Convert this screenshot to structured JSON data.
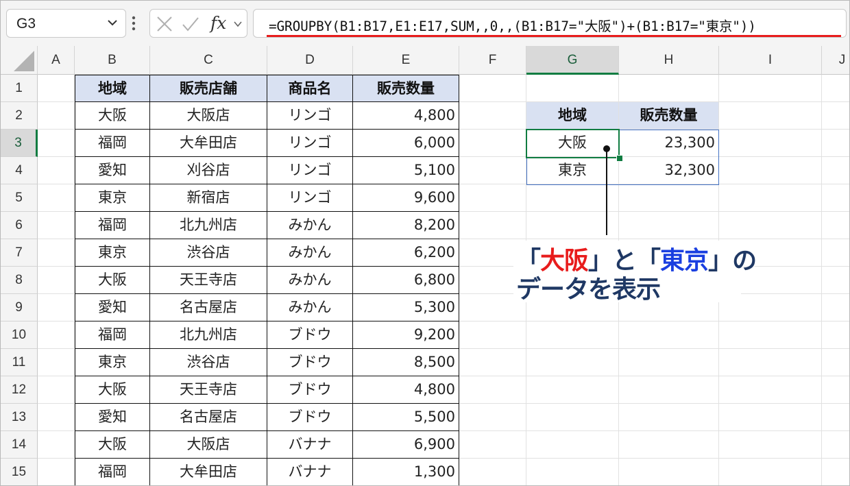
{
  "formula_bar": {
    "name_box": "G3",
    "formula": "=GROUPBY(B1:B17,E1:E17,SUM,,0,,(B1:B17=\"大阪\")+(B1:B17=\"東京\"))",
    "icons": [
      "chevron-down-icon",
      "more-vertical-icon",
      "cancel-icon",
      "enter-check-icon",
      "function-icon"
    ]
  },
  "grid": {
    "columns": [
      "A",
      "B",
      "C",
      "D",
      "E",
      "F",
      "G",
      "H",
      "I",
      "J"
    ],
    "selected_column": "G",
    "rows": [
      "1",
      "2",
      "3",
      "4",
      "5",
      "6",
      "7",
      "8",
      "9",
      "10",
      "11",
      "12",
      "13",
      "14",
      "15"
    ],
    "selected_row": "3"
  },
  "table": {
    "headers": [
      "地域",
      "販売店舗",
      "商品名",
      "販売数量"
    ],
    "rows": [
      [
        "大阪",
        "大阪店",
        "リンゴ",
        "4,800"
      ],
      [
        "福岡",
        "大牟田店",
        "リンゴ",
        "6,000"
      ],
      [
        "愛知",
        "刈谷店",
        "リンゴ",
        "5,100"
      ],
      [
        "東京",
        "新宿店",
        "リンゴ",
        "9,600"
      ],
      [
        "福岡",
        "北九州店",
        "みかん",
        "8,200"
      ],
      [
        "東京",
        "渋谷店",
        "みかん",
        "6,200"
      ],
      [
        "大阪",
        "天王寺店",
        "みかん",
        "6,800"
      ],
      [
        "愛知",
        "名古屋店",
        "みかん",
        "5,300"
      ],
      [
        "福岡",
        "北九州店",
        "ブドウ",
        "9,200"
      ],
      [
        "東京",
        "渋谷店",
        "ブドウ",
        "8,500"
      ],
      [
        "大阪",
        "天王寺店",
        "ブドウ",
        "4,800"
      ],
      [
        "愛知",
        "名古屋店",
        "ブドウ",
        "5,500"
      ],
      [
        "大阪",
        "大阪店",
        "バナナ",
        "6,900"
      ],
      [
        "福岡",
        "大牟田店",
        "バナナ",
        "1,300"
      ]
    ]
  },
  "result": {
    "headers": [
      "地域",
      "販売数量"
    ],
    "rows": [
      [
        "大阪",
        "23,300"
      ],
      [
        "東京",
        "32,300"
      ]
    ]
  },
  "annotation": {
    "line1_open": "「",
    "line1_osaka": "大阪",
    "line1_mid": "」と「",
    "line1_tokyo": "東京",
    "line1_close": "」の",
    "line2": "データを表示"
  },
  "colors": {
    "header_fill": "#d9e1f2",
    "selection": "#107c41",
    "spill_border": "#4472c4",
    "underline": "#e81c1c",
    "annotation_text": "#1f3864",
    "annotation_red": "#e81c1c",
    "annotation_blue": "#1a3fe0"
  }
}
